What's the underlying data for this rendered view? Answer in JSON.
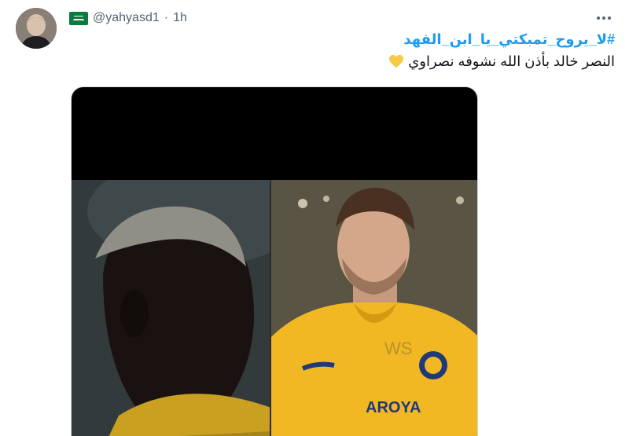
{
  "author": {
    "handle": "@yahyasd1",
    "separator": "·",
    "time": "1h",
    "flag_icon": "saudi-flag-icon",
    "avatar_icon": "profile-avatar"
  },
  "tweet": {
    "hashtag": "#لا_يروح_تمبكتي_يا_ابن_الفهد",
    "text": "النصر خالد بأذن الله نشوفه نصراوي",
    "heart_color": "#f7c948"
  },
  "media": {
    "shirt_text_left": "AROYA",
    "shirt_text_right": "WS"
  },
  "colors": {
    "link": "#1d9bf0",
    "secondary": "#536471",
    "jersey": "#f2b824"
  }
}
